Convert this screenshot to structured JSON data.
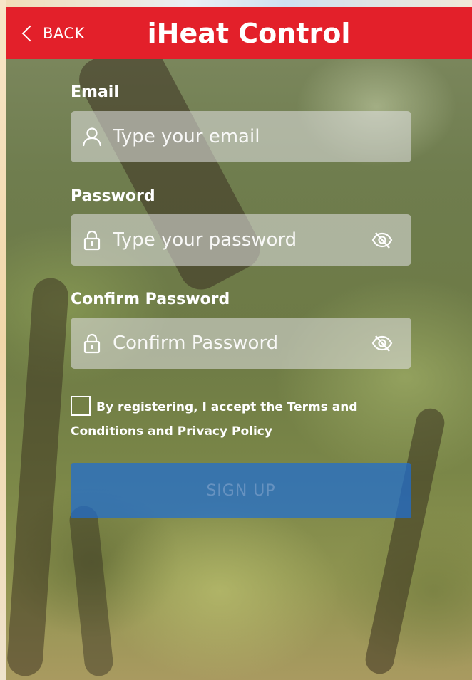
{
  "header": {
    "back_label": "BACK",
    "title": "iHeat Control",
    "background_color": "#e3202a"
  },
  "form": {
    "email": {
      "label": "Email",
      "placeholder": "Type your email",
      "value": "",
      "icon": "user-icon"
    },
    "password": {
      "label": "Password",
      "placeholder": "Type your password",
      "value": "",
      "icon": "lock-icon",
      "toggle_icon": "eye-slash-icon"
    },
    "confirm_password": {
      "label": "Confirm Password",
      "placeholder": "Confirm Password",
      "value": "",
      "icon": "lock-icon",
      "toggle_icon": "eye-slash-icon"
    },
    "terms": {
      "checked": false,
      "prefix": "By registering, I accept the ",
      "terms_link": "Terms and Conditions",
      "conjunction": " and ",
      "privacy_link": "Privacy Policy"
    },
    "submit_label": "SIGN UP",
    "submit_color": "#1e6ed2"
  }
}
